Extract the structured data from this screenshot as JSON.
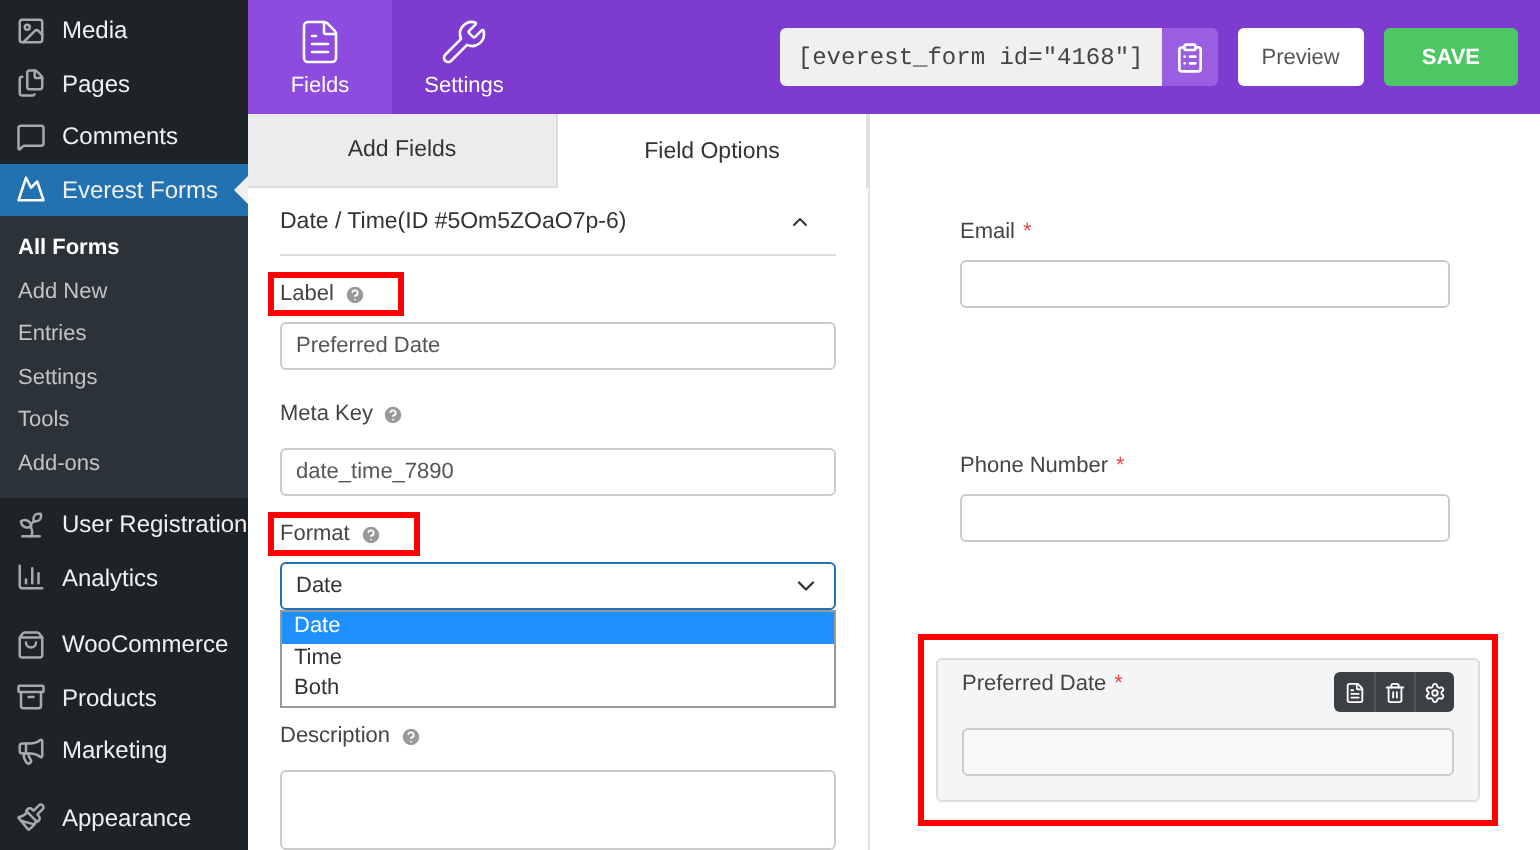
{
  "sidebar": {
    "items": [
      {
        "label": "Media",
        "kind": "menu",
        "selected": false
      },
      {
        "label": "Pages",
        "kind": "menu",
        "selected": false
      },
      {
        "label": "Comments",
        "kind": "menu",
        "selected": false
      },
      {
        "label": "Everest Forms",
        "kind": "menu",
        "selected": true
      },
      {
        "label": "All Forms",
        "kind": "sub",
        "selected": true
      },
      {
        "label": "Add New",
        "kind": "sub",
        "selected": false
      },
      {
        "label": "Entries",
        "kind": "sub",
        "selected": false
      },
      {
        "label": "Settings",
        "kind": "sub",
        "selected": false
      },
      {
        "label": "Tools",
        "kind": "sub",
        "selected": false
      },
      {
        "label": "Add-ons",
        "kind": "sub",
        "selected": false
      },
      {
        "label": "User Registration",
        "kind": "menu",
        "selected": false
      },
      {
        "label": "Analytics",
        "kind": "menu",
        "selected": false
      },
      {
        "label": "WooCommerce",
        "kind": "menu",
        "selected": false
      },
      {
        "label": "Products",
        "kind": "menu",
        "selected": false
      },
      {
        "label": "Marketing",
        "kind": "menu",
        "selected": false
      },
      {
        "label": "Appearance",
        "kind": "menu",
        "selected": false
      }
    ]
  },
  "header": {
    "tabs": [
      {
        "label": "Fields",
        "selected": true
      },
      {
        "label": "Settings",
        "selected": false
      }
    ],
    "shortcode": "[everest_form id=\"4168\"]",
    "preview_button": "Preview",
    "save_button": "SAVE"
  },
  "panel": {
    "tabs": [
      {
        "label": "Add Fields",
        "selected": false
      },
      {
        "label": "Field Options",
        "selected": true
      }
    ],
    "section_title": "Date / Time(ID #5Om5ZOaO7p-6)",
    "expanded": true,
    "fields": [
      {
        "kind": "input",
        "label": "Label",
        "highlighted": true,
        "value": "Preferred Date"
      },
      {
        "kind": "input",
        "label": "Meta Key",
        "highlighted": false,
        "value": "date_time_7890"
      },
      {
        "kind": "dropdown",
        "label": "Format",
        "highlighted": true,
        "value": "Date",
        "options": [
          {
            "label": "Date",
            "selected": true
          },
          {
            "label": "Time",
            "selected": false
          },
          {
            "label": "Both",
            "selected": false
          }
        ]
      },
      {
        "kind": "textarea",
        "label": "Description",
        "highlighted": false
      }
    ]
  },
  "preview": {
    "fields": [
      {
        "label": "Email",
        "required_mark": "*",
        "active": false
      },
      {
        "label": "Phone Number",
        "required_mark": "*",
        "active": false
      },
      {
        "label": "Preferred Date",
        "required_mark": "*",
        "active": true,
        "highlighted": true
      }
    ]
  }
}
